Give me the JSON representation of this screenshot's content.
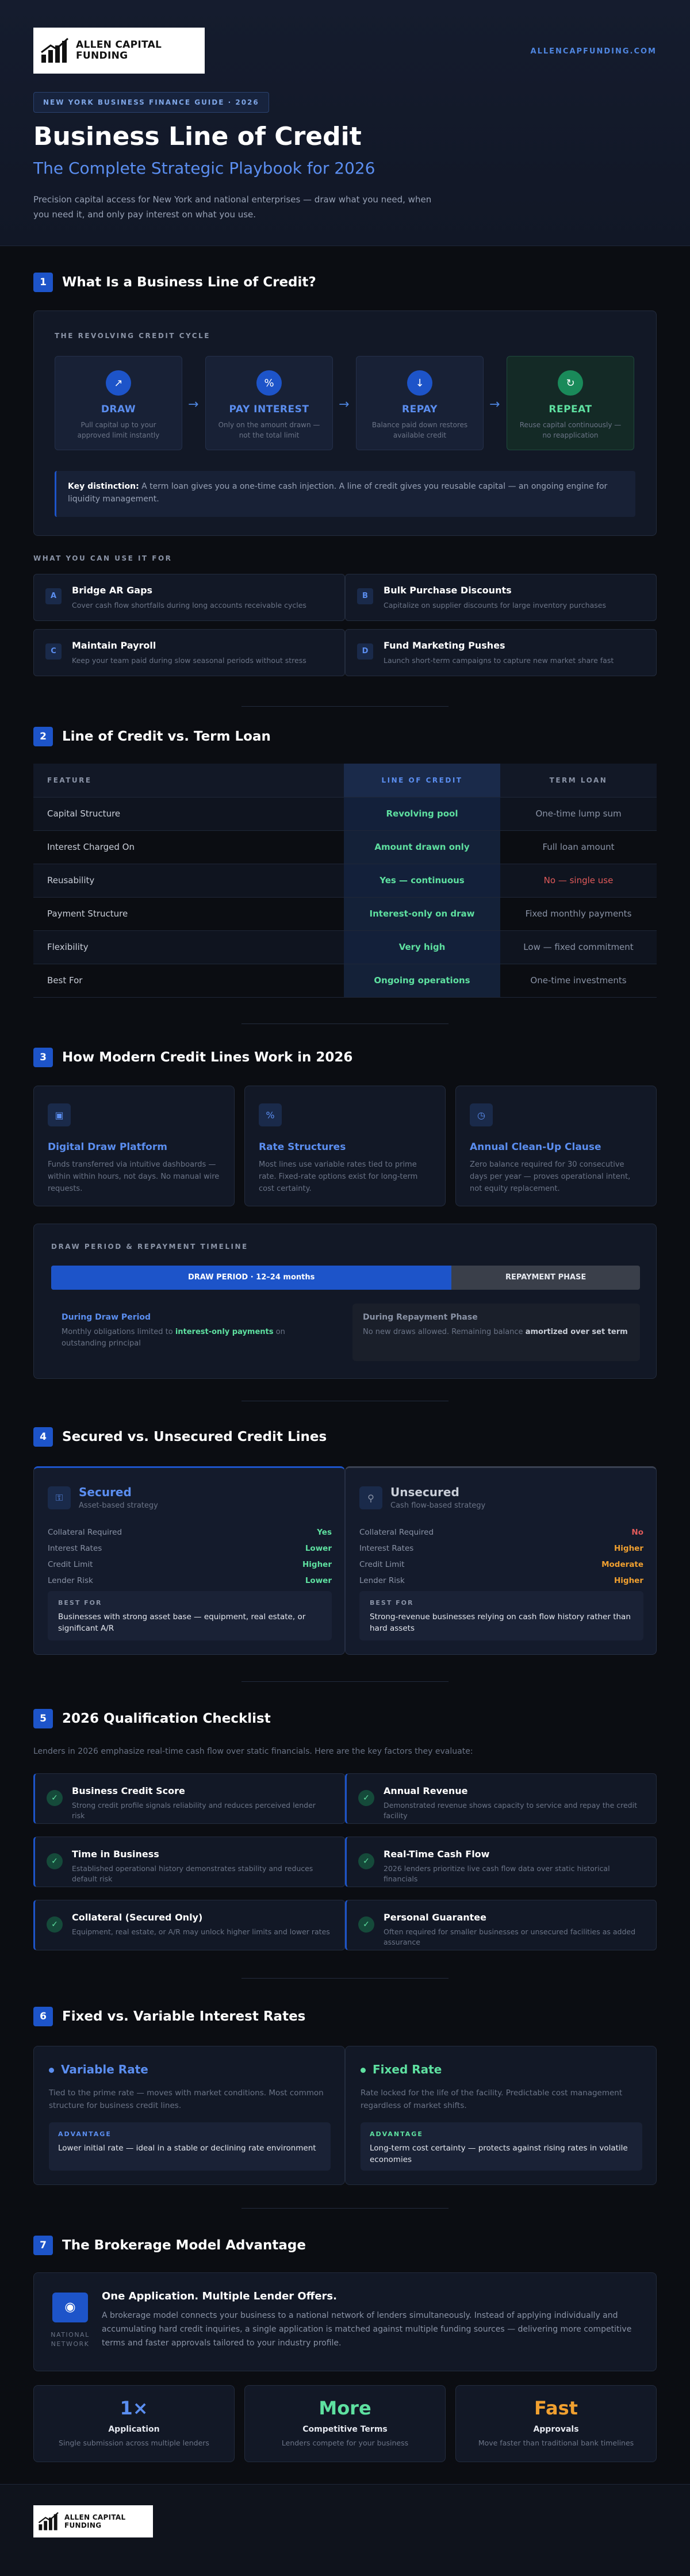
{
  "header": {
    "logo_text_1": "ALLEN CAPITAL",
    "logo_text_2": "FUNDING",
    "site": "ALLENCAPFUNDING.COM",
    "pill": "NEW YORK BUSINESS FINANCE GUIDE · 2026",
    "title": "Business Line of Credit",
    "subtitle": "The Complete Strategic Playbook for 2026",
    "intro": "Precision capital access for New York and national enterprises — draw what you need, when you need it, and only pay interest on what you use."
  },
  "s1": {
    "num": "1",
    "title": "What Is a Business Line of Credit?",
    "cycle_label": "THE REVOLVING CREDIT CYCLE",
    "cycle": [
      {
        "icon": "arrow-up-icon",
        "title": "DRAW",
        "desc": "Pull capital up to your approved limit instantly"
      },
      {
        "icon": "percent-icon",
        "title": "PAY INTEREST",
        "desc": "Only on the amount drawn — not the total limit"
      },
      {
        "icon": "arrow-down-icon",
        "title": "REPAY",
        "desc": "Balance paid down restores available credit"
      },
      {
        "icon": "refresh-icon",
        "title": "REPEAT",
        "desc": "Reuse capital continuously — no reapplication"
      }
    ],
    "key_label": "Key distinction:",
    "key_text": "A term loan gives you a one-time cash injection. A line of credit gives you reusable capital — an ongoing engine for liquidity management.",
    "uses_label": "WHAT YOU CAN USE IT FOR",
    "uses": [
      {
        "badge": "A",
        "title": "Bridge AR Gaps",
        "desc": "Cover cash flow shortfalls during long accounts receivable cycles"
      },
      {
        "badge": "B",
        "title": "Bulk Purchase Discounts",
        "desc": "Capitalize on supplier discounts for large inventory purchases"
      },
      {
        "badge": "C",
        "title": "Maintain Payroll",
        "desc": "Keep your team paid during slow seasonal periods without stress"
      },
      {
        "badge": "D",
        "title": "Fund Marketing Pushes",
        "desc": "Launch short-term campaigns to capture new market share fast"
      }
    ]
  },
  "s2": {
    "num": "2",
    "title": "Line of Credit vs. Term Loan",
    "headers": [
      "FEATURE",
      "LINE OF CREDIT",
      "TERM LOAN"
    ],
    "rows": [
      {
        "f": "Capital Structure",
        "loc": "Revolving pool",
        "tl": "One-time lump sum",
        "tl_color": "#8a93a6"
      },
      {
        "f": "Interest Charged On",
        "loc": "Amount drawn only",
        "tl": "Full loan amount",
        "tl_color": "#8a93a6"
      },
      {
        "f": "Reusability",
        "loc": "Yes — continuous",
        "tl": "No — single use",
        "tl_color": "#e05a5a"
      },
      {
        "f": "Payment Structure",
        "loc": "Interest-only on draw",
        "tl": "Fixed monthly payments",
        "tl_color": "#8a93a6"
      },
      {
        "f": "Flexibility",
        "loc": "Very high",
        "tl": "Low — fixed commitment",
        "tl_color": "#8a93a6"
      },
      {
        "f": "Best For",
        "loc": "Ongoing operations",
        "tl": "One-time investments",
        "tl_color": "#8a93a6"
      }
    ]
  },
  "s3": {
    "num": "3",
    "title": "How Modern Credit Lines Work in 2026",
    "features": [
      {
        "icon": "monitor-icon",
        "title": "Digital Draw Platform",
        "desc": "Funds transferred via intuitive dashboards — within within hours, not days. No manual wire requests."
      },
      {
        "icon": "percent-icon",
        "title": "Rate Structures",
        "desc": "Most lines use variable rates tied to prime rate. Fixed-rate options exist for long-term cost certainty."
      },
      {
        "icon": "clock-icon",
        "title": "Annual Clean-Up Clause",
        "desc": "Zero balance required for 30 consecutive days per year — proves operational intent, not equity replacement."
      }
    ],
    "timeline_label": "DRAW PERIOD & REPAYMENT TIMELINE",
    "draw_bar": "DRAW PERIOD · 12–24 months",
    "repay_bar": "REPAYMENT PHASE",
    "draw_fraction": 0.68,
    "during_draw_title": "During Draw Period",
    "during_draw_pre": "Monthly obligations limited to ",
    "during_draw_hl": "interest-only payments",
    "during_draw_post": " on outstanding principal",
    "during_repay_title": "During Repayment Phase",
    "during_repay_pre": "No new draws allowed. Remaining balance ",
    "during_repay_hl": "amortized over set term"
  },
  "s4": {
    "num": "4",
    "title": "Secured vs. Unsecured Credit Lines",
    "cards": [
      {
        "icon": "lock-icon",
        "title": "Secured",
        "sub": "Asset-based strategy",
        "rows": [
          {
            "k": "Collateral Required",
            "v": "Yes",
            "c": "#5ee0a0"
          },
          {
            "k": "Interest Rates",
            "v": "Lower",
            "c": "#5ee0a0"
          },
          {
            "k": "Credit Limit",
            "v": "Higher",
            "c": "#5ee0a0"
          },
          {
            "k": "Lender Risk",
            "v": "Lower",
            "c": "#5ee0a0"
          }
        ],
        "bf_label": "BEST FOR",
        "bf": "Businesses with strong asset base — equipment, real estate, or significant A/R"
      },
      {
        "icon": "key-icon",
        "title": "Unsecured",
        "sub": "Cash flow-based strategy",
        "rows": [
          {
            "k": "Collateral Required",
            "v": "No",
            "c": "#e05a5a"
          },
          {
            "k": "Interest Rates",
            "v": "Higher",
            "c": "#f0a030"
          },
          {
            "k": "Credit Limit",
            "v": "Moderate",
            "c": "#f0a030"
          },
          {
            "k": "Lender Risk",
            "v": "Higher",
            "c": "#f0a030"
          }
        ],
        "bf_label": "BEST FOR",
        "bf": "Strong-revenue businesses relying on cash flow history rather than hard assets"
      }
    ]
  },
  "s5": {
    "num": "5",
    "title": "2026 Qualification Checklist",
    "intro": "Lenders in 2026 emphasize real-time cash flow over static financials. Here are the key factors they evaluate:",
    "items": [
      {
        "title": "Business Credit Score",
        "desc": "Strong credit profile signals reliability and reduces perceived lender risk"
      },
      {
        "title": "Annual Revenue",
        "desc": "Demonstrated revenue shows capacity to service and repay the credit facility"
      },
      {
        "title": "Time in Business",
        "desc": "Established operational history demonstrates stability and reduces default risk"
      },
      {
        "title": "Real-Time Cash Flow",
        "desc": "2026 lenders prioritize live cash flow data over static historical financials"
      },
      {
        "title": "Collateral (Secured Only)",
        "desc": "Equipment, real estate, or A/R may unlock higher limits and lower rates"
      },
      {
        "title": "Personal Guarantee",
        "desc": "Often required for smaller businesses or unsecured facilities as added assurance"
      }
    ]
  },
  "s6": {
    "num": "6",
    "title": "Fixed vs. Variable Interest Rates",
    "cards": [
      {
        "title": "Variable Rate",
        "color": "#5b8ef0",
        "desc": "Tied to the prime rate — moves with market conditions. Most common structure for business credit lines.",
        "adv_label": "ADVANTAGE",
        "adv": "Lower initial rate — ideal in a stable or declining rate environment"
      },
      {
        "title": "Fixed Rate",
        "color": "#5ee0a0",
        "desc": "Rate locked for the life of the facility. Predictable cost management regardless of market shifts.",
        "adv_label": "ADVANTAGE",
        "adv": "Long-term cost certainty — protects against rising rates in volatile economies"
      }
    ]
  },
  "s7": {
    "num": "7",
    "title": "The Brokerage Model Advantage",
    "network_label_1": "NATIONAL",
    "network_label_2": "NETWORK",
    "card_title": "One Application. Multiple Lender Offers.",
    "card_desc": "A brokerage model connects your business to a national network of lenders simultaneously. Instead of applying individually and accumulating hard credit inquiries, a single application is matched against multiple funding sources — delivering more competitive terms and faster approvals tailored to your industry profile.",
    "stats": [
      {
        "n": "1×",
        "c": "#5b8ef0",
        "t": "Application",
        "d": "Single submission across multiple lenders"
      },
      {
        "n": "More",
        "c": "#5ee0a0",
        "t": "Competitive Terms",
        "d": "Lenders compete for your business"
      },
      {
        "n": "Fast",
        "c": "#f0a030",
        "t": "Approvals",
        "d": "Move faster than traditional bank timelines"
      }
    ]
  },
  "footer": {
    "logo_text_1": "ALLEN CAPITAL",
    "logo_text_2": "FUNDING"
  }
}
